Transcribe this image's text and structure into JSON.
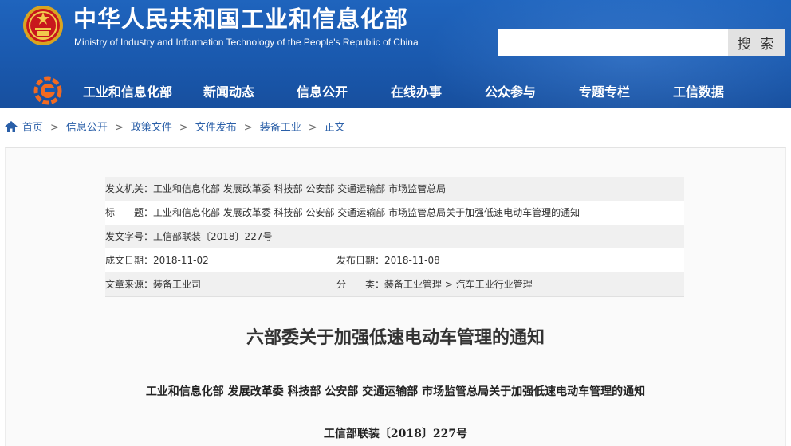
{
  "header": {
    "title_cn": "中华人民共和国工业和信息化部",
    "title_en": "Ministry of Industry and Information Technology of the People's Republic of China",
    "search_placeholder": "",
    "search_button": "搜 索"
  },
  "nav": {
    "items": [
      {
        "label": "工业和信息化部"
      },
      {
        "label": "新闻动态"
      },
      {
        "label": "信息公开"
      },
      {
        "label": "在线办事"
      },
      {
        "label": "公众参与"
      },
      {
        "label": "专题专栏"
      },
      {
        "label": "工信数据"
      }
    ]
  },
  "breadcrumb": {
    "items": [
      "首页",
      "信息公开",
      "政策文件",
      "文件发布",
      "装备工业"
    ],
    "separator": ">",
    "current": "正文"
  },
  "meta": {
    "issuer_label": "发文机关：",
    "issuer": "工业和信息化部 发展改革委 科技部 公安部 交通运输部 市场监管总局",
    "title_label": "标　　题：",
    "title": "工业和信息化部 发展改革委 科技部 公安部 交通运输部 市场监管总局关于加强低速电动车管理的通知",
    "doc_no_label": "发文字号：",
    "doc_no": "工信部联装〔2018〕227号",
    "written_date_label": "成文日期：",
    "written_date": "2018-11-02",
    "publish_date_label": "发布日期：",
    "publish_date": "2018-11-08",
    "source_label": "文章来源：",
    "source": "装备工业司",
    "category_label": "分　　类：",
    "category": "装备工业管理 > 汽车工业行业管理"
  },
  "document": {
    "title": "六部委关于加强低速电动车管理的通知",
    "subtitle": "工业和信息化部 发展改革委 科技部 公安部 交通运输部 市场监管总局关于加强低速电动车管理的通知",
    "number": "工信部联装〔2018〕227号"
  },
  "colors": {
    "header_blue": "#1a59ae",
    "link_blue": "#2a5fa8",
    "row_shade": "#f0f0f0"
  },
  "icons": {
    "emblem": "national-emblem-icon",
    "nav_logo": "miit-logo-icon",
    "home": "home-icon"
  }
}
